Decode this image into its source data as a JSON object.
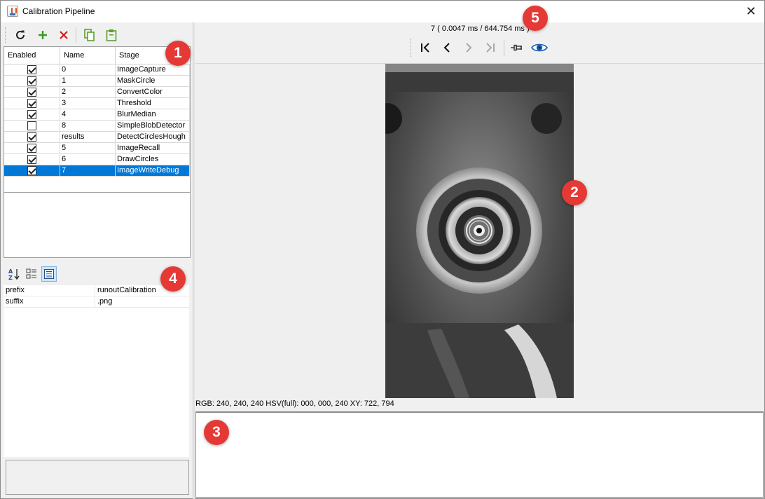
{
  "window": {
    "title": "Calibration Pipeline",
    "close_glyph": "✕"
  },
  "toolbar": {
    "icons": [
      "refresh-icon",
      "add-icon",
      "delete-icon",
      "copy-icon",
      "paste-icon"
    ],
    "colors": {
      "add": "#3a9b1f",
      "delete": "#d11a1a",
      "copy": "#5aa02c"
    }
  },
  "stages_table": {
    "headers": [
      "Enabled",
      "Name",
      "Stage"
    ],
    "rows": [
      {
        "enabled": true,
        "name": "0",
        "stage": "ImageCapture"
      },
      {
        "enabled": true,
        "name": "1",
        "stage": "MaskCircle"
      },
      {
        "enabled": true,
        "name": "2",
        "stage": "ConvertColor"
      },
      {
        "enabled": true,
        "name": "3",
        "stage": "Threshold"
      },
      {
        "enabled": true,
        "name": "4",
        "stage": "BlurMedian"
      },
      {
        "enabled": false,
        "name": "8",
        "stage": "SimpleBlobDetector"
      },
      {
        "enabled": true,
        "name": "results",
        "stage": "DetectCirclesHough"
      },
      {
        "enabled": true,
        "name": "5",
        "stage": "ImageRecall"
      },
      {
        "enabled": true,
        "name": "6",
        "stage": "DrawCircles"
      },
      {
        "enabled": true,
        "name": "7",
        "stage": "ImageWriteDebug",
        "selected": true
      }
    ],
    "selection_color": "#0078d7"
  },
  "properties": {
    "rows": [
      {
        "name": "prefix",
        "value": "runoutCalibration"
      },
      {
        "name": "suffix",
        "value": ".png"
      }
    ]
  },
  "viewer": {
    "frame_info": "7 ( 0.0047 ms / 644.754 ms )",
    "pixel_info": "RGB: 240, 240, 240 HSV(full): 000, 000, 240 XY: 722, 794",
    "eye_color": "#1d5fb0"
  },
  "annotations": {
    "badge_1": "1",
    "badge_2": "2",
    "badge_3": "3",
    "badge_4": "4",
    "badge_5": "5",
    "color": "#e53935"
  }
}
